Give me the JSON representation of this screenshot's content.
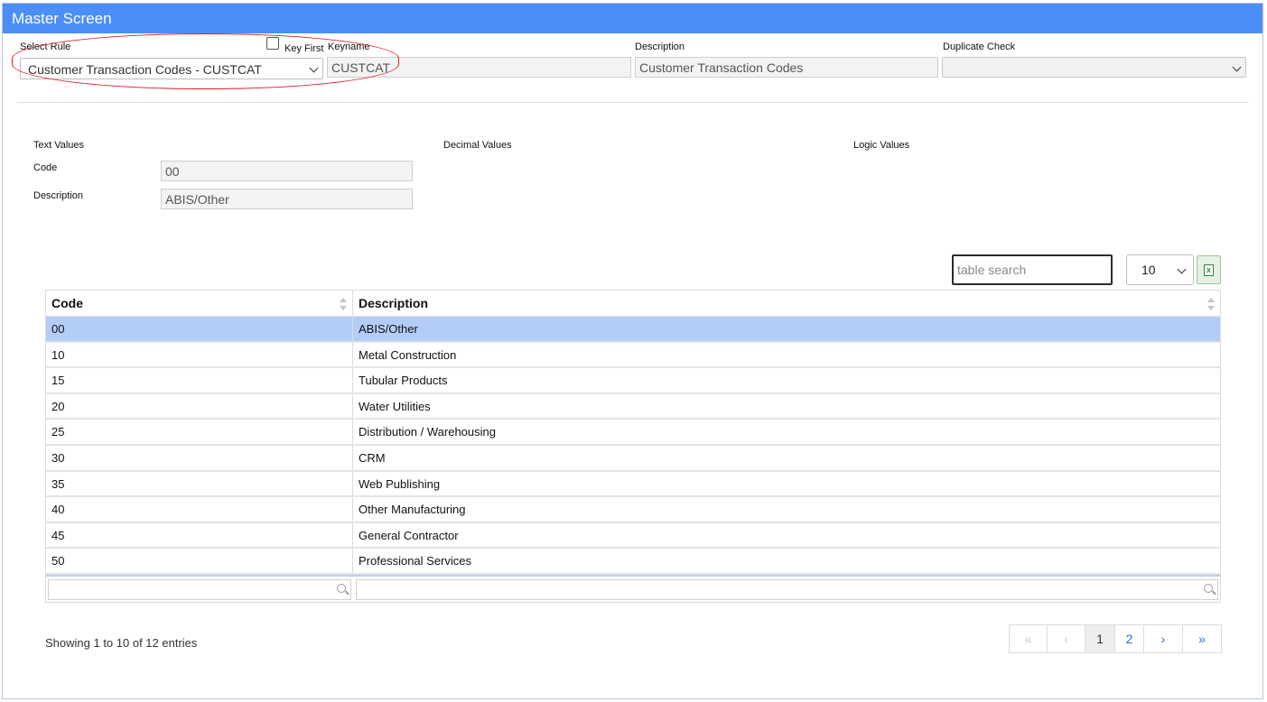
{
  "window": {
    "title": "Master Screen"
  },
  "header": {
    "select_rule_label": "Select Rule",
    "select_rule_value": "Customer Transaction Codes - CUSTCAT",
    "key_first_label": "Key First",
    "key_first_checked": false,
    "keyname_label": "Keyname",
    "keyname_value": "CUSTCAT",
    "description_label": "Description",
    "description_value": "Customer Transaction Codes",
    "duplicate_check_label": "Duplicate Check",
    "duplicate_check_value": ""
  },
  "values": {
    "text_values_label": "Text Values",
    "decimal_values_label": "Decimal Values",
    "logic_values_label": "Logic Values",
    "code_label": "Code",
    "code_value": "00",
    "description_label": "Description",
    "description_value": "ABIS/Other"
  },
  "table_controls": {
    "search_placeholder": "table search",
    "page_length": "10",
    "excel_icon": "excel-export-icon"
  },
  "table": {
    "columns": [
      "Code",
      "Description"
    ],
    "rows": [
      {
        "code": "00",
        "description": "ABIS/Other",
        "selected": true
      },
      {
        "code": "10",
        "description": "Metal Construction"
      },
      {
        "code": "15",
        "description": "Tubular Products"
      },
      {
        "code": "20",
        "description": "Water Utilities"
      },
      {
        "code": "25",
        "description": "Distribution / Warehousing"
      },
      {
        "code": "30",
        "description": "CRM"
      },
      {
        "code": "35",
        "description": "Web Publishing"
      },
      {
        "code": "40",
        "description": "Other Manufacturing"
      },
      {
        "code": "45",
        "description": "General Contractor"
      },
      {
        "code": "50",
        "description": "Professional Services"
      }
    ]
  },
  "footer": {
    "info": "Showing 1 to 10 of 12 entries",
    "pages": {
      "first": "«",
      "prev": "‹",
      "p1": "1",
      "p2": "2",
      "next": "›",
      "last": "»"
    }
  },
  "colors": {
    "titlebar": "#4c8ef7",
    "selected_row": "#b4cdf7",
    "annotation": "#e01b24"
  }
}
